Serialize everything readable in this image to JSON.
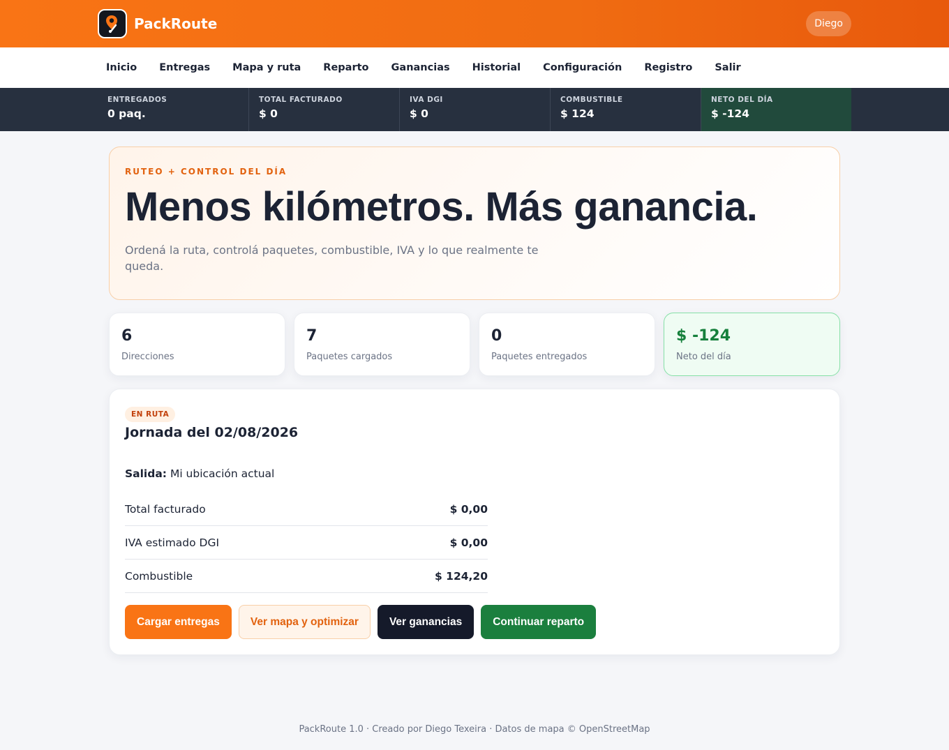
{
  "app": {
    "name": "PackRoute",
    "user": "Diego"
  },
  "icons": {
    "logo": "route-pin-icon"
  },
  "colors": {
    "brand_orange": "#f97415",
    "dark": "#27303f",
    "success": "#16803c"
  },
  "nav": [
    {
      "label": "Inicio"
    },
    {
      "label": "Entregas"
    },
    {
      "label": "Mapa y ruta"
    },
    {
      "label": "Reparto"
    },
    {
      "label": "Ganancias"
    },
    {
      "label": "Historial"
    },
    {
      "label": "Configuración"
    },
    {
      "label": "Registro"
    },
    {
      "label": "Salir"
    }
  ],
  "stats": [
    {
      "label": "ENTREGADOS",
      "value": "0 paq."
    },
    {
      "label": "TOTAL FACTURADO",
      "value": "$ 0"
    },
    {
      "label": "IVA DGI",
      "value": "$ 0"
    },
    {
      "label": "COMBUSTIBLE",
      "value": "$ 124"
    },
    {
      "label": "NETO DEL DÍA",
      "value": "$ -124"
    }
  ],
  "hero": {
    "kicker": "RUTEO + CONTROL DEL DÍA",
    "title": "Menos kilómetros. Más ganancia.",
    "subtitle": "Ordená la ruta, controlá paquetes, combustible, IVA y lo que realmente te queda."
  },
  "cards": [
    {
      "value": "6",
      "label": "Direcciones"
    },
    {
      "value": "7",
      "label": "Paquetes cargados"
    },
    {
      "value": "0",
      "label": "Paquetes entregados"
    },
    {
      "value": "$ -124",
      "label": "Neto del día"
    }
  ],
  "journey": {
    "badge": "EN RUTA",
    "title": "Jornada del 02/08/2026",
    "departure_label": "Salida:",
    "departure_value": "Mi ubicación actual",
    "rows": [
      {
        "label": "Total facturado",
        "value": "$ 0,00"
      },
      {
        "label": "IVA estimado DGI",
        "value": "$ 0,00"
      },
      {
        "label": "Combustible",
        "value": "$ 124,20"
      }
    ],
    "buttons": {
      "load": "Cargar entregas",
      "map": "Ver mapa y optimizar",
      "earnings": "Ver ganancias",
      "continue": "Continuar reparto"
    }
  },
  "footer": "PackRoute 1.0 · Creado por Diego Texeira · Datos de mapa © OpenStreetMap"
}
